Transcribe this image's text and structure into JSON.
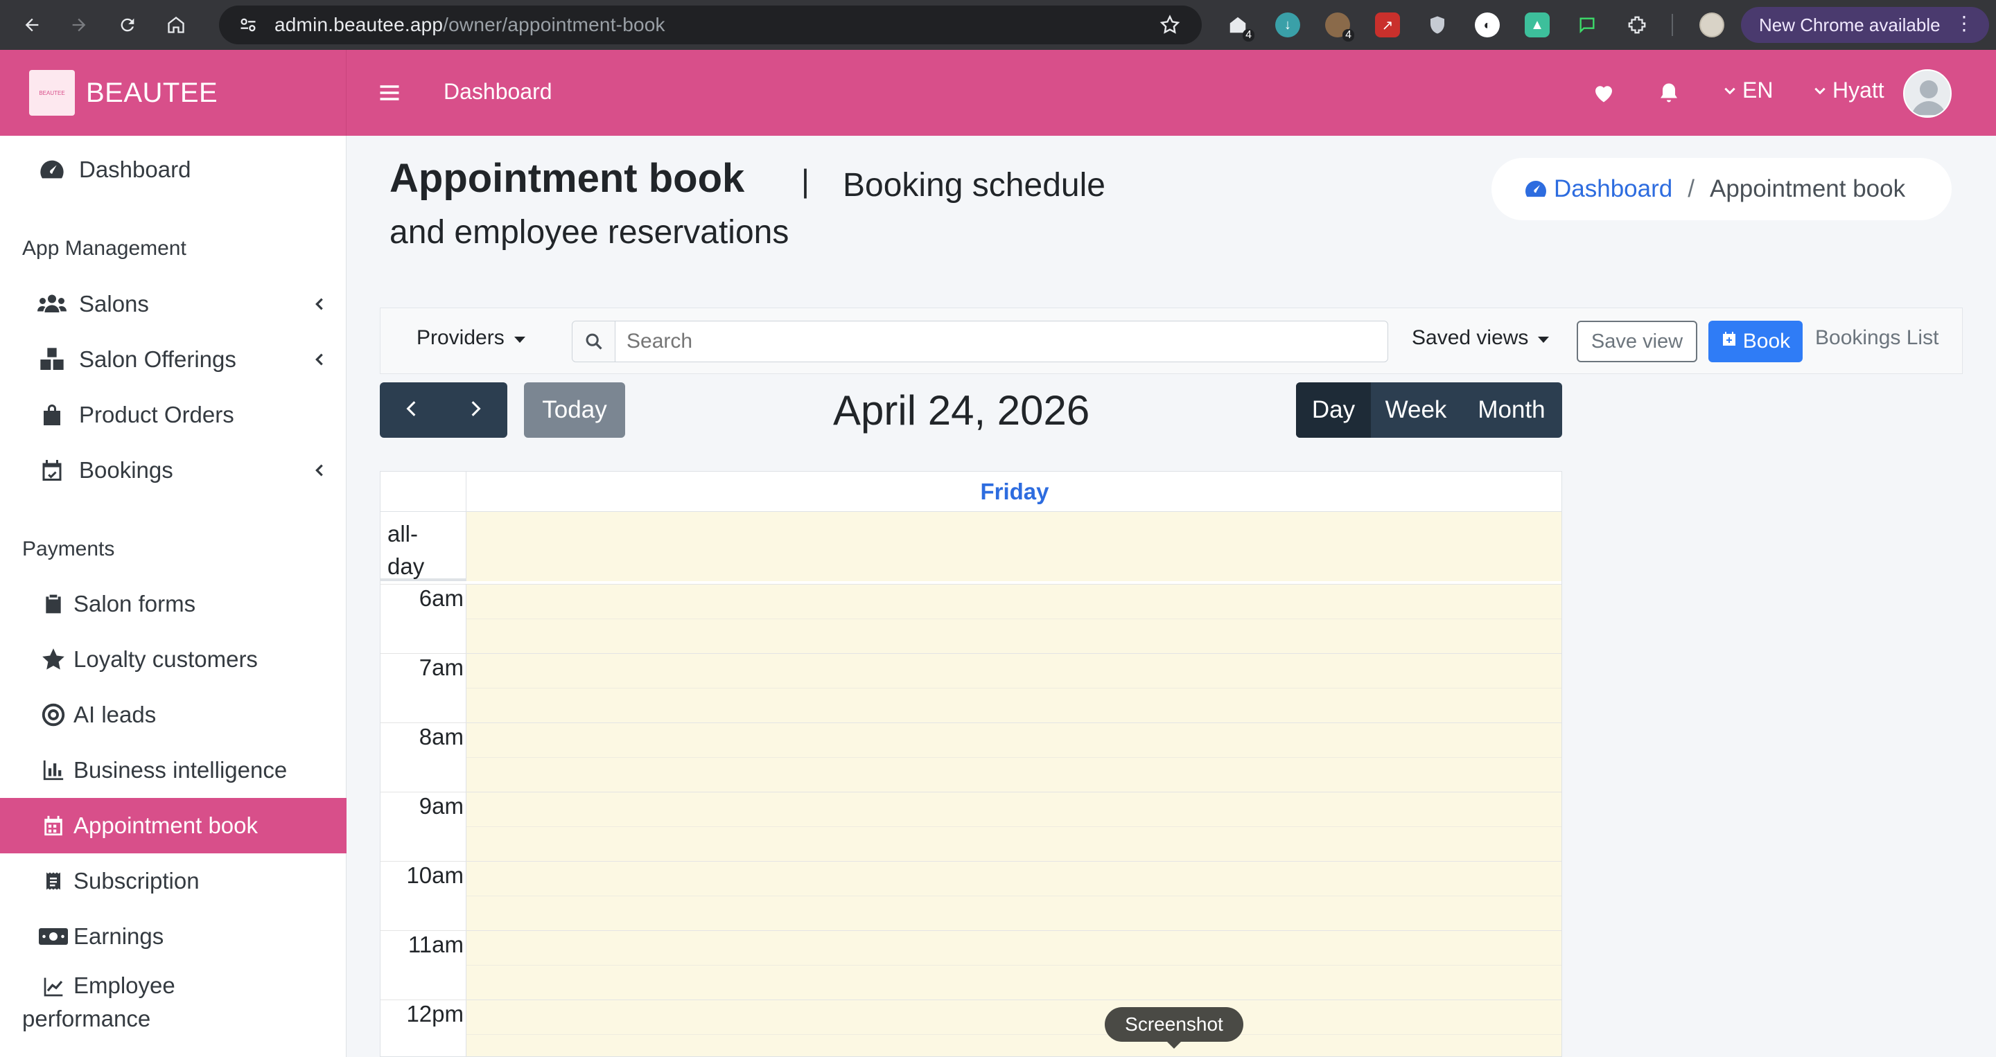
{
  "browser": {
    "url_host": "admin.beautee.app",
    "url_path": "/owner/appointment-book",
    "update_label": "New Chrome available",
    "ext_badges": [
      "4",
      "4"
    ]
  },
  "app": {
    "brand": "BEAUTEE",
    "brand_logo_text": "BEAUTEE",
    "topbar_title": "Dashboard",
    "language": "EN",
    "user": "Hyatt",
    "accent_color": "#d84f8a"
  },
  "sidebar": {
    "dashboard": "Dashboard",
    "section_app": "App Management",
    "salons": "Salons",
    "salon_offerings": "Salon Offerings",
    "product_orders": "Product Orders",
    "bookings": "Bookings",
    "section_payments": "Payments",
    "salon_forms": "Salon forms",
    "loyalty_customers": "Loyalty customers",
    "ai_leads": "AI leads",
    "business_intelligence": "Business intelligence",
    "appointment_book": "Appointment book",
    "subscription": "Subscription",
    "earnings": "Earnings",
    "employee_performance_1": "Employee",
    "employee_performance_2": "performance"
  },
  "header": {
    "title": "Appointment book",
    "separator": "|",
    "subtitle_line1": "Booking schedule",
    "subtitle_line2": "and employee reservations"
  },
  "breadcrumb": {
    "home": "Dashboard",
    "separator": "/",
    "current": "Appointment book"
  },
  "toolbar": {
    "providers": "Providers",
    "search_placeholder": "Search",
    "saved_views": "Saved views",
    "save_view": "Save view",
    "book": "Book",
    "bookings_list": "Bookings List"
  },
  "calendar": {
    "today": "Today",
    "date_title": "April 24, 2026",
    "views": [
      "Day",
      "Week",
      "Month"
    ],
    "active_view": "Day",
    "day_name": "Friday",
    "allday_1": "all-",
    "allday_2": "day",
    "hours": [
      "6am",
      "7am",
      "8am",
      "9am",
      "10am",
      "11am",
      "12pm"
    ]
  },
  "tooltip": "Screenshot"
}
